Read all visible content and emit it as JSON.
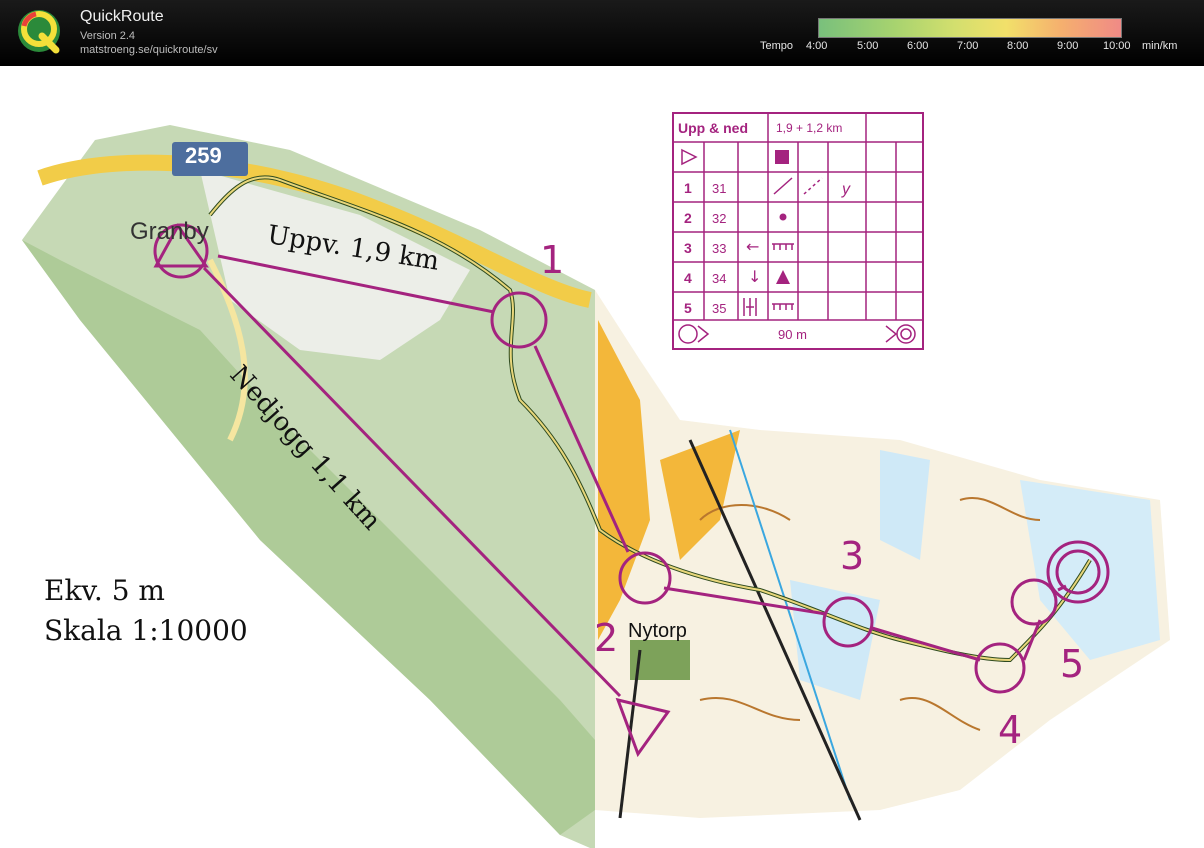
{
  "app": {
    "title": "QuickRoute",
    "version": "Version 2.4",
    "url": "matstroeng.se/quickroute/sv"
  },
  "tempo": {
    "label": "Tempo",
    "ticks": [
      "4:00",
      "5:00",
      "6:00",
      "7:00",
      "8:00",
      "9:00",
      "10:00"
    ],
    "unit": "min/km"
  },
  "legend": {
    "title": "Upp & ned",
    "distance": "1,9 + 1,2 km",
    "controls": [
      {
        "n": "1",
        "code": "31"
      },
      {
        "n": "2",
        "code": "32"
      },
      {
        "n": "3",
        "code": "33"
      },
      {
        "n": "4",
        "code": "34"
      },
      {
        "n": "5",
        "code": "35"
      }
    ],
    "finish_distance": "90 m"
  },
  "map": {
    "road_number": "259",
    "places": [
      "Granby",
      "Nytorp"
    ],
    "route_labels": [
      "Uppv. 1,9 km",
      "Nedjogg 1,1 km"
    ],
    "info_lines": [
      "Ekv. 5 m",
      "Skala 1:10000"
    ],
    "control_numbers": [
      "1",
      "2",
      "3",
      "4",
      "5"
    ]
  },
  "colors": {
    "course": "#a4237f",
    "road": "#f5d35a",
    "forest_green": "#b9d3a7",
    "water": "#5bb8e6"
  }
}
